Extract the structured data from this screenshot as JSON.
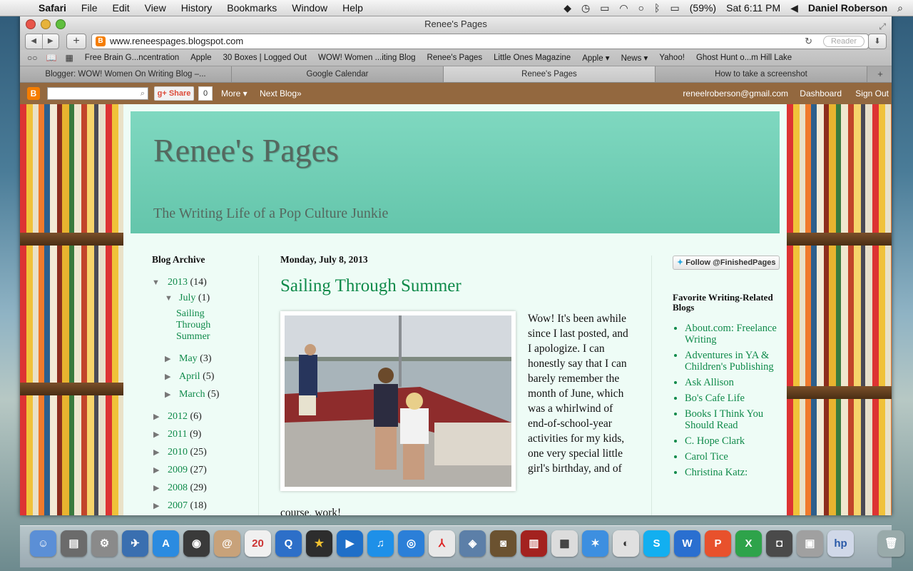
{
  "menubar": {
    "apple_icon": "apple-logo",
    "items": [
      "Safari",
      "File",
      "Edit",
      "View",
      "History",
      "Bookmarks",
      "Window",
      "Help"
    ],
    "battery": "(59%)",
    "clock": "Sat 6:11 PM",
    "user": "Daniel Roberson"
  },
  "window": {
    "title": "Renee's Pages",
    "url": "www.reneespages.blogspot.com",
    "reader_label": "Reader"
  },
  "bookmarks": [
    "Free Brain G...ncentration",
    "Apple",
    "30 Boxes | Logged Out",
    "WOW! Women ...iting Blog",
    "Renee's Pages",
    "Little Ones Magazine",
    "Apple ▾",
    "News ▾",
    "Yahoo!",
    "Ghost Hunt o...m Hill Lake"
  ],
  "tabs": [
    {
      "label": "Blogger: WOW! Women On Writing Blog –..."
    },
    {
      "label": "Google Calendar"
    },
    {
      "label": "Renee's Pages"
    },
    {
      "label": "How to take a screenshot"
    }
  ],
  "blogger_bar": {
    "share_label": "Share",
    "share_count": "0",
    "more_label": "More ▾",
    "next_label": "Next Blog»",
    "email": "reneelroberson@gmail.com",
    "dashboard_label": "Dashboard",
    "signout_label": "Sign Out"
  },
  "blog": {
    "title": "Renee's Pages",
    "subtitle": "The Writing Life of a Pop Culture Junkie"
  },
  "archive": {
    "title": "Blog Archive",
    "year2013": "2013",
    "year2013_count": "(14)",
    "july": "July",
    "july_count": "(1)",
    "july_post": "Sailing Through Summer",
    "months": [
      {
        "name": "May",
        "count": "(3)"
      },
      {
        "name": "April",
        "count": "(5)"
      },
      {
        "name": "March",
        "count": "(5)"
      }
    ],
    "years": [
      {
        "name": "2012",
        "count": "(6)"
      },
      {
        "name": "2011",
        "count": "(9)"
      },
      {
        "name": "2010",
        "count": "(25)"
      },
      {
        "name": "2009",
        "count": "(27)"
      },
      {
        "name": "2008",
        "count": "(29)"
      },
      {
        "name": "2007",
        "count": "(18)"
      }
    ]
  },
  "post": {
    "date": "Monday, July 8, 2013",
    "title": "Sailing Through Summer",
    "body": "Wow! It's been awhile since I last posted, and I apologize. I can honestly say that I can barely remember the month of June, which was a whirlwind of end-of-school-year activities for my kids, one very special little girl's birthday, and of",
    "body_cont": "course, work!"
  },
  "right_sidebar": {
    "follow_label": "Follow @FinishedPages",
    "title": "Favorite Writing-Related Blogs",
    "links": [
      "About.com: Freelance Writing",
      "Adventures in YA & Children's Publishing",
      "Ask Allison",
      "Bo's Cafe Life",
      "Books I Think You Should Read",
      "C. Hope Clark",
      "Carol Tice",
      "Christina Katz:"
    ]
  }
}
